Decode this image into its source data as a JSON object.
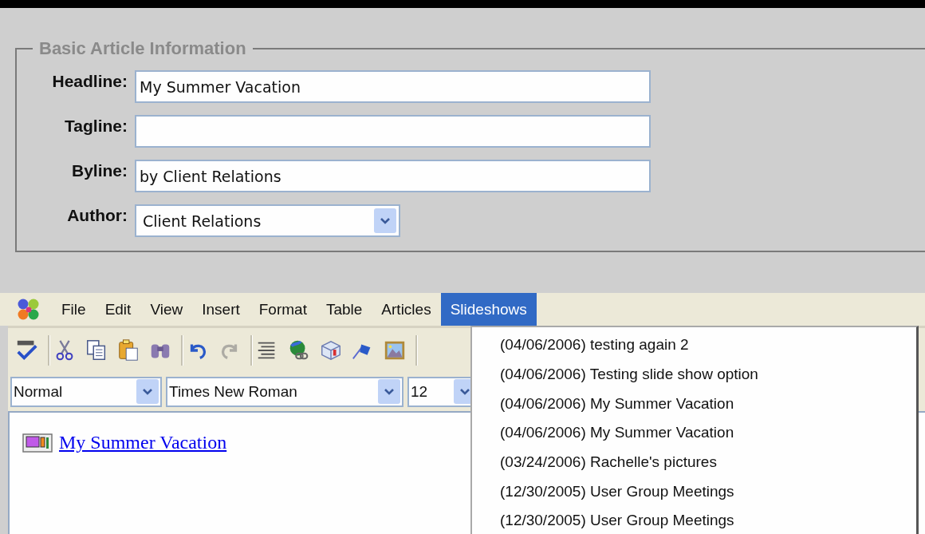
{
  "form": {
    "legend": "Basic Article Information",
    "fields": [
      {
        "label": "Headline:",
        "kind": "text",
        "value": "My Summer Vacation"
      },
      {
        "label": "Tagline:",
        "kind": "text"
      },
      {
        "label": "Byline:",
        "kind": "text",
        "value": "by Client Relations"
      },
      {
        "label": "Author:",
        "kind": "select",
        "value": "Client Relations"
      }
    ]
  },
  "menu": [
    {
      "label": "File",
      "selected": false
    },
    {
      "label": "Edit",
      "selected": false
    },
    {
      "label": "View",
      "selected": false
    },
    {
      "label": "Insert",
      "selected": false
    },
    {
      "label": "Format",
      "selected": false
    },
    {
      "label": "Table",
      "selected": false
    },
    {
      "label": "Articles",
      "selected": false
    },
    {
      "label": "Slideshows",
      "selected": true
    }
  ],
  "toolbar": {
    "groups": [
      {
        "buttons": [
          {
            "disabled": false
          }
        ]
      },
      {
        "buttons": [
          {
            "disabled": false
          },
          {
            "disabled": false
          },
          {
            "disabled": false
          },
          {
            "disabled": false
          }
        ]
      },
      {
        "buttons": [
          {
            "disabled": false
          },
          {
            "disabled": true
          }
        ]
      },
      {
        "buttons": [
          {
            "disabled": false
          },
          {
            "disabled": false
          },
          {
            "disabled": false
          },
          {
            "disabled": false
          },
          {
            "disabled": false
          }
        ]
      }
    ]
  },
  "format_bar": [
    {
      "value": "Normal"
    },
    {
      "value": "Times New Roman"
    },
    {
      "value": "12"
    }
  ],
  "editor": {
    "link": "My Summer Vacation"
  },
  "slideshows_menu": {
    "items": [
      "(04/06/2006) testing again 2",
      "(04/06/2006) Testing slide show option",
      "(04/06/2006) My Summer Vacation",
      "(04/06/2006) My Summer Vacation",
      "(03/24/2006) Rachelle's pictures",
      "(12/30/2005) User Group Meetings",
      "(12/30/2005) User Group Meetings"
    ]
  }
}
